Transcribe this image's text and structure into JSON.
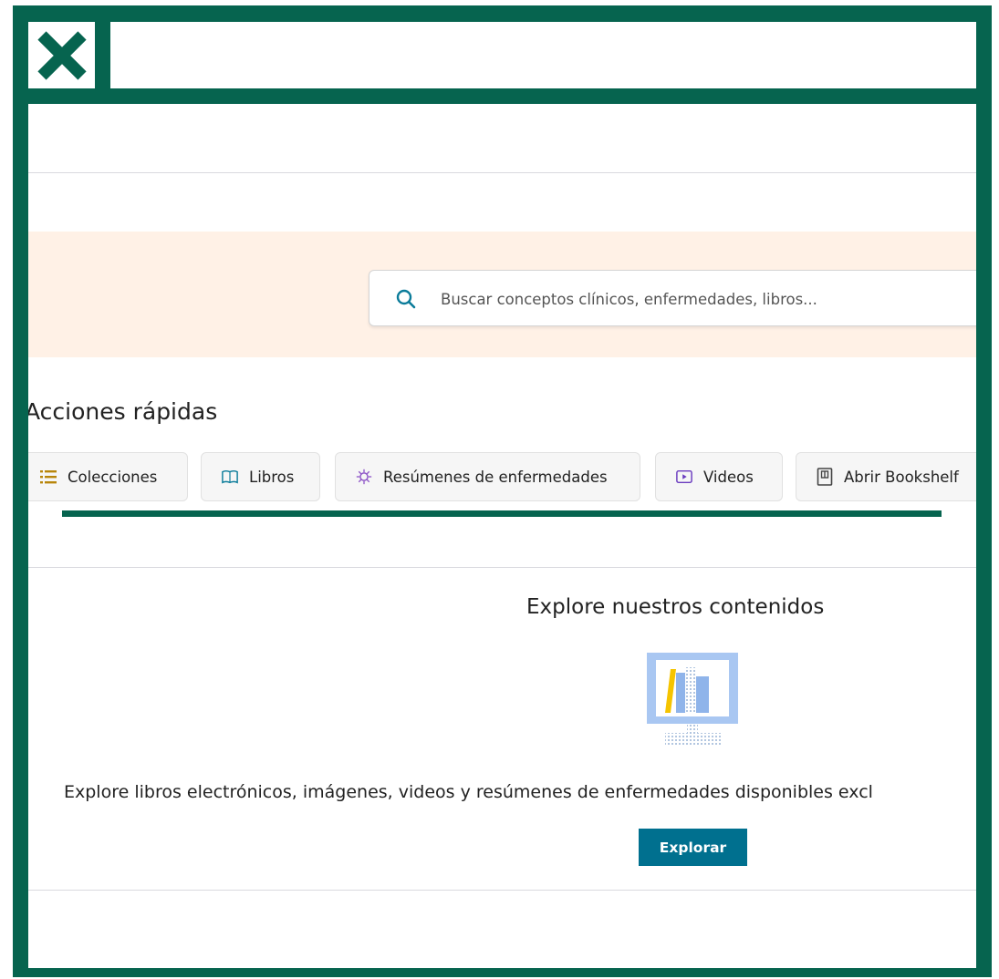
{
  "search": {
    "placeholder": "Buscar conceptos clínicos, enfermedades, libros..."
  },
  "quick_actions": {
    "title": "Acciones rápidas",
    "items": [
      {
        "label": "Colecciones",
        "icon": "list-icon"
      },
      {
        "label": "Libros",
        "icon": "book-icon"
      },
      {
        "label": "Resúmenes de enfermedades",
        "icon": "virus-icon"
      },
      {
        "label": "Videos",
        "icon": "video-icon"
      },
      {
        "label": "Abrir Bookshelf",
        "icon": "bookshelf-icon"
      }
    ]
  },
  "explore": {
    "title": "Explore nuestros contenidos",
    "description": "Explore libros electrónicos, imágenes, videos y resúmenes de enfermedades disponibles excl",
    "button_label": "Explorar"
  },
  "colors": {
    "frame": "#06644f",
    "search_band": "#fff1e6",
    "primary_button": "#00708f",
    "icon_accent": "#0b7c9a"
  }
}
